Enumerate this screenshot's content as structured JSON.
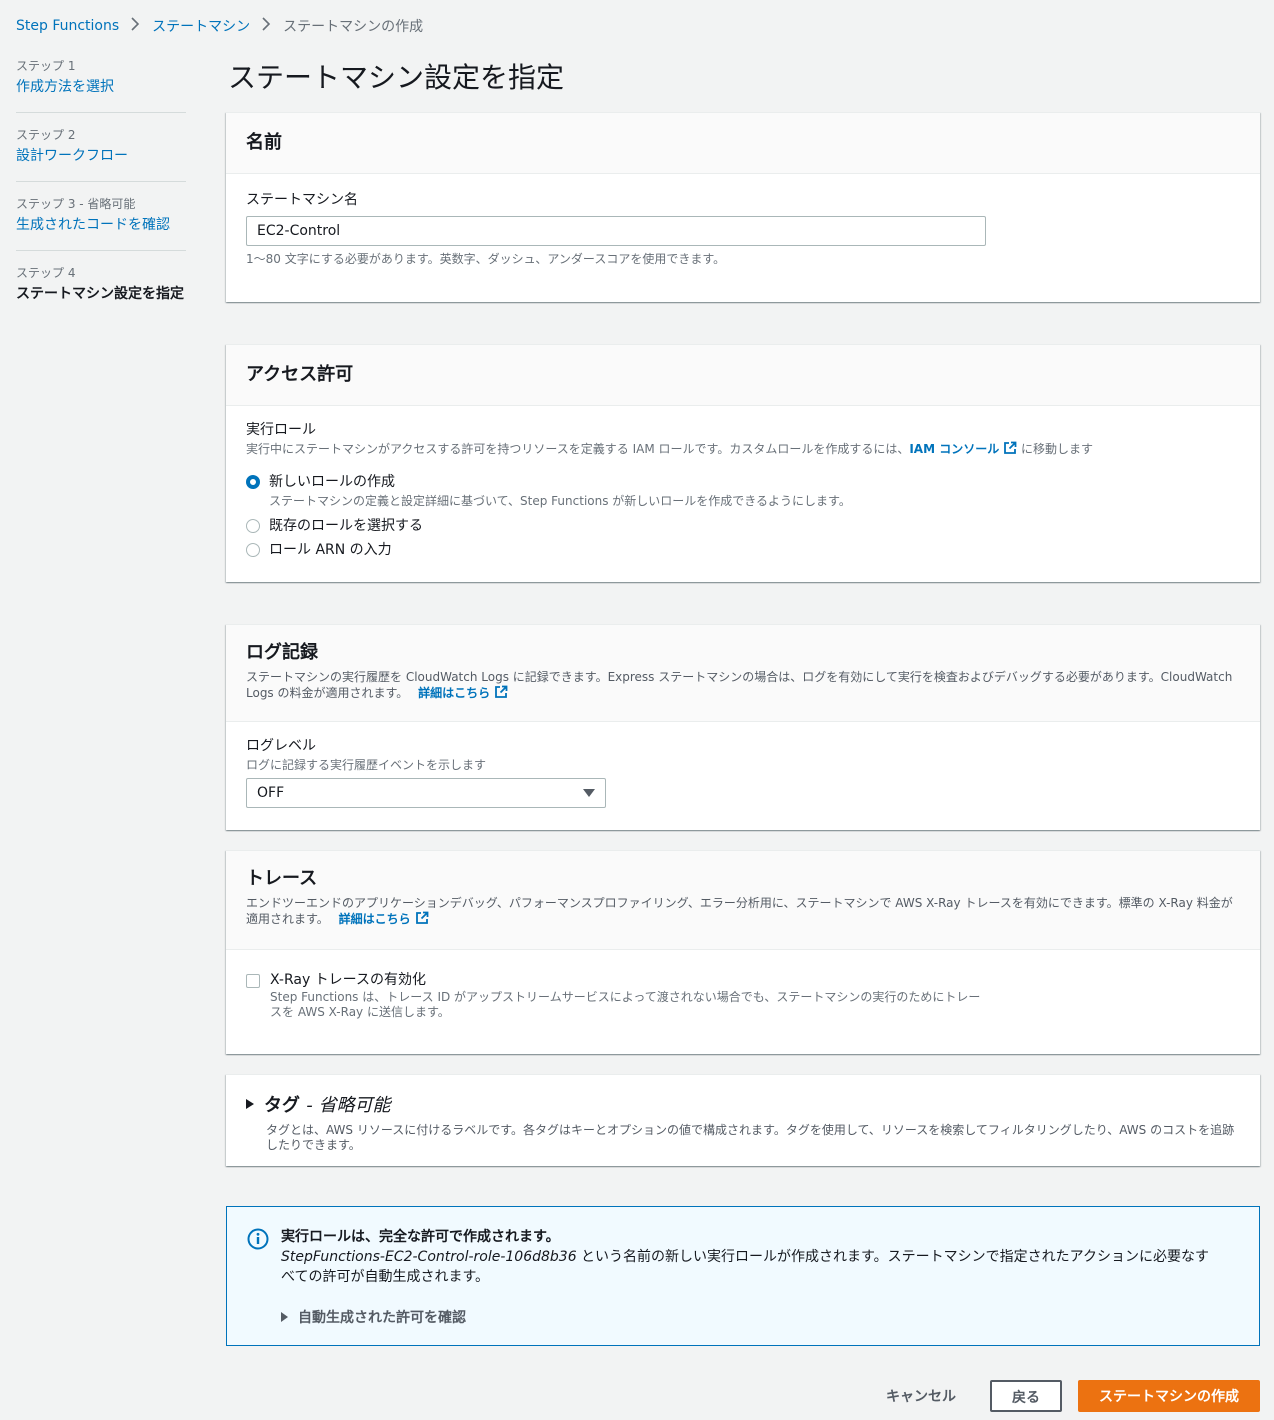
{
  "breadcrumb": {
    "items": [
      "Step Functions",
      "ステートマシン",
      "ステートマシンの作成"
    ]
  },
  "sidenav": {
    "steps": [
      {
        "num": "ステップ 1",
        "title": "作成方法を選択"
      },
      {
        "num": "ステップ 2",
        "title": "設計ワークフロー"
      },
      {
        "num": "ステップ 3 - 省略可能",
        "title": "生成されたコードを確認"
      },
      {
        "num": "ステップ 4",
        "title": "ステートマシン設定を指定"
      }
    ]
  },
  "page": {
    "title": "ステートマシン設定を指定"
  },
  "name_panel": {
    "header": "名前",
    "field_label": "ステートマシン名",
    "value": "EC2-Control",
    "hint": "1～80 文字にする必要があります。英数字、ダッシュ、アンダースコアを使用できます。"
  },
  "access_panel": {
    "header": "アクセス許可",
    "role_label": "実行ロール",
    "role_desc_prefix": "実行中にステートマシンがアクセスする許可を持つリソースを定義する IAM ロールです。カスタムロールを作成するには、",
    "role_desc_link": "IAM コンソール",
    "role_desc_suffix": "に移動します",
    "options": [
      {
        "label": "新しいロールの作成",
        "desc": "ステートマシンの定義と設定詳細に基づいて、Step Functions が新しいロールを作成できるようにします。",
        "checked": true
      },
      {
        "label": "既存のロールを選択する",
        "desc": "",
        "checked": false
      },
      {
        "label": "ロール ARN の入力",
        "desc": "",
        "checked": false
      }
    ]
  },
  "logging_panel": {
    "header": "ログ記録",
    "desc": "ステートマシンの実行履歴を CloudWatch Logs に記録できます。Express ステートマシンの場合は、ログを有効にして実行を検査およびデバッグする必要があります。CloudWatch Logs の料金が適用されます。",
    "link": "詳細はこちら",
    "level_label": "ログレベル",
    "level_desc": "ログに記録する実行履歴イベントを示します",
    "level_value": "OFF"
  },
  "tracing_panel": {
    "header": "トレース",
    "desc": "エンドツーエンドのアプリケーションデバッグ、パフォーマンスプロファイリング、エラー分析用に、ステートマシンで AWS X-Ray トレースを有効にできます。標準の X-Ray 料金が適用されます。",
    "link": "詳細はこちら",
    "checkbox_label": "X-Ray トレースの有効化",
    "checkbox_desc": "Step Functions は、トレース ID がアップストリームサービスによって渡されない場合でも、ステートマシンの実行のためにトレースを AWS X-Ray に送信します。"
  },
  "tags_panel": {
    "header": "タグ",
    "optional": "- 省略可能",
    "desc": "タグとは、AWS リソースに付けるラベルです。各タグはキーとオプションの値で構成されます。タグを使用して、リソースを検索してフィルタリングしたり、AWS のコストを追跡したりできます。"
  },
  "info_box": {
    "title": "実行ロールは、完全な許可で作成されます。",
    "role_name": "StepFunctions-EC2-Control-role-106d8b36",
    "text": " という名前の新しい実行ロールが作成されます。ステートマシンで指定されたアクションに必要なすべての許可が自動生成されます。",
    "expander": "自動生成された許可を確認"
  },
  "actions": {
    "cancel": "キャンセル",
    "back": "戻る",
    "create": "ステートマシンの作成"
  },
  "colors": {
    "link": "#0073bb",
    "primary": "#ec7211",
    "info_bg": "#f1faff"
  }
}
